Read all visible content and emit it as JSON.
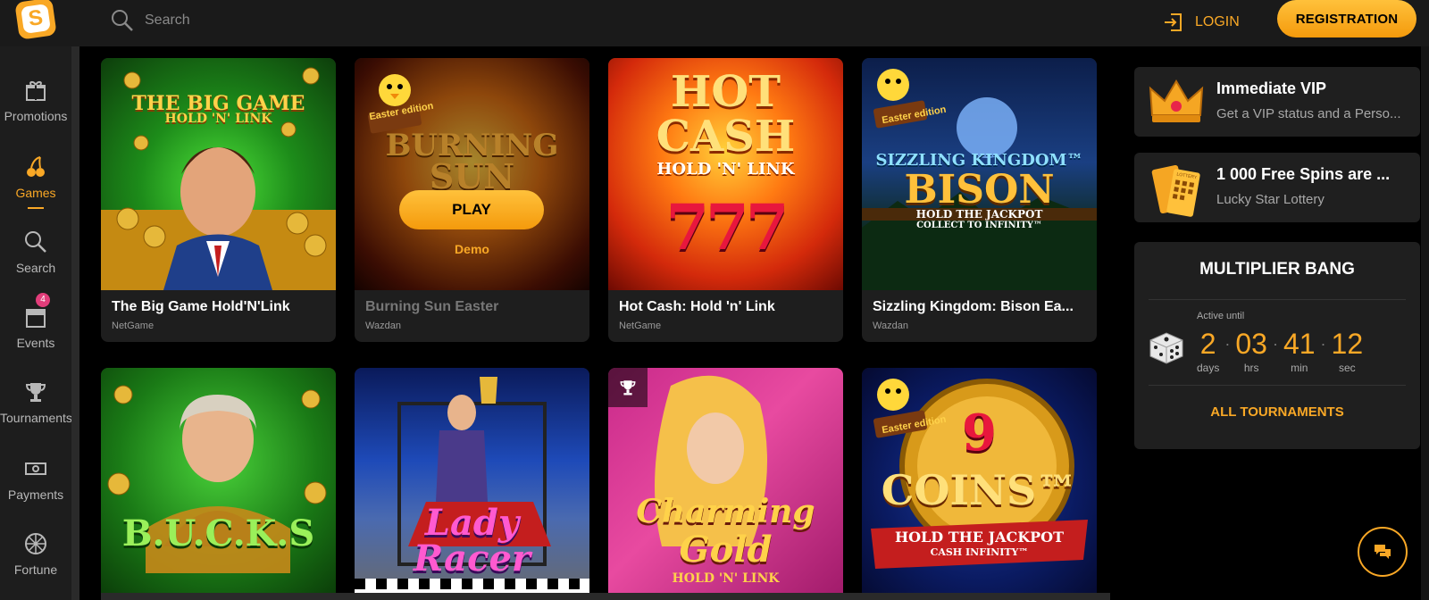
{
  "header": {
    "logo_letter": "S",
    "search_placeholder": "Search",
    "login_label": "LOGIN",
    "register_label": "REGISTRATION"
  },
  "sidebar": {
    "items": [
      {
        "label": "Promotions",
        "icon": "gift-icon"
      },
      {
        "label": "Games",
        "icon": "cherry-icon",
        "active": true
      },
      {
        "label": "Search",
        "icon": "search-icon"
      },
      {
        "label": "Events",
        "icon": "calendar-icon",
        "badge": "4"
      },
      {
        "label": "Tournaments",
        "icon": "trophy-icon"
      },
      {
        "label": "Payments",
        "icon": "cash-icon"
      },
      {
        "label": "Fortune",
        "icon": "wheel-icon"
      }
    ]
  },
  "games": [
    {
      "title": "The Big Game Hold'N'Link",
      "provider": "NetGame",
      "art_line1": "THE BIG GAME",
      "art_line2": "HOLD 'N' LINK"
    },
    {
      "title": "Burning Sun Easter",
      "provider": "Wazdan",
      "art_line1": "BURNING",
      "art_line2": "SUN",
      "easter": "Easter edition",
      "play_label": "PLAY",
      "demo_label": "Demo"
    },
    {
      "title": "Hot Cash: Hold 'n' Link",
      "provider": "NetGame",
      "art_line1": "HOT",
      "art_line2": "CASH",
      "art_line3": "HOLD 'N' LINK",
      "art_line4": "777"
    },
    {
      "title": "Sizzling Kingdom: Bison Ea...",
      "provider": "Wazdan",
      "art_line1": "SIZZLING KINGDOM™",
      "art_line2": "BISON",
      "art_line3": "HOLD THE JACKPOT",
      "art_line4": "COLLECT TO INFINITY™",
      "easter": "Easter edition"
    },
    {
      "art_line1": "B.U.C.K.S"
    },
    {
      "art_line1": "Lady",
      "art_line2": "Racer"
    },
    {
      "art_line1": "Charming",
      "art_line2": "Gold",
      "art_line3": "HOLD 'N' LINK"
    },
    {
      "art_line1": "9",
      "art_line2": "COINS™",
      "art_line3": "HOLD THE JACKPOT",
      "art_line4": "CASH INFINITY™",
      "easter": "Easter edition"
    }
  ],
  "promos": [
    {
      "title": "Immediate VIP",
      "subtitle": "Get a VIP status and a Perso...",
      "icon": "crown-icon"
    },
    {
      "title": "1 000 Free Spins are ...",
      "subtitle": "Lucky Star Lottery",
      "icon": "lottery-ticket-icon",
      "ticket_text": "LOTTERY"
    }
  ],
  "tournament": {
    "title": "MULTIPLIER BANG",
    "active_until_label": "Active until",
    "countdown": [
      {
        "value": "2",
        "unit": "days"
      },
      {
        "value": "03",
        "unit": "hrs"
      },
      {
        "value": "41",
        "unit": "min"
      },
      {
        "value": "12",
        "unit": "sec"
      }
    ],
    "all_label": "ALL TOURNAMENTS"
  },
  "colors": {
    "accent": "#f9a826",
    "background": "#000000",
    "panel": "#1f1f1f"
  }
}
